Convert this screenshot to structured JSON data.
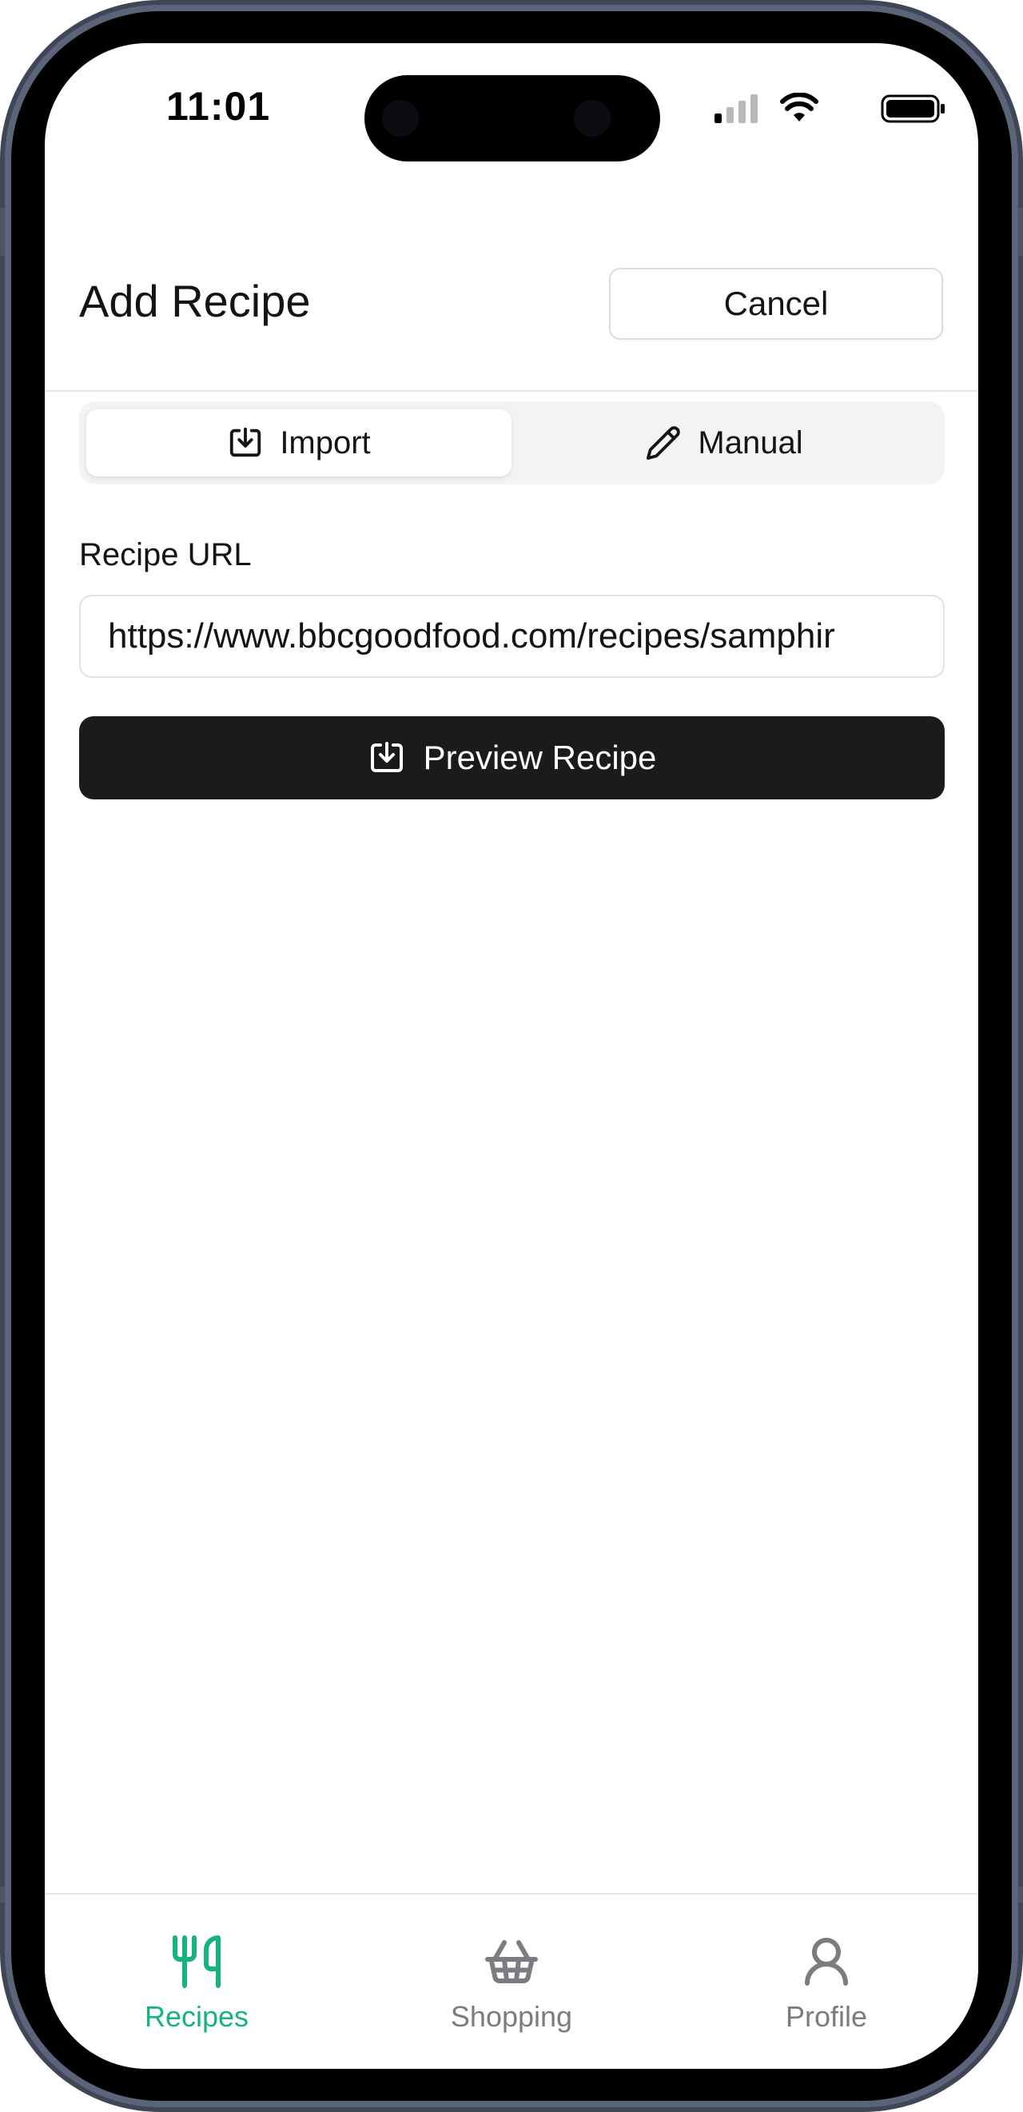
{
  "status_bar": {
    "time": "11:01"
  },
  "header": {
    "title": "Add Recipe",
    "cancel_label": "Cancel"
  },
  "segment": {
    "import_label": "Import",
    "manual_label": "Manual",
    "selected": "Import"
  },
  "form": {
    "url_label": "Recipe URL",
    "url_value": "https://www.bbcgoodfood.com/recipes/samphir",
    "preview_label": "Preview Recipe"
  },
  "tabbar": {
    "items": [
      {
        "label": "Recipes",
        "icon": "utensils-icon",
        "active": true
      },
      {
        "label": "Shopping",
        "icon": "basket-icon",
        "active": false
      },
      {
        "label": "Profile",
        "icon": "user-icon",
        "active": false
      }
    ]
  },
  "colors": {
    "accent": "#16b47c",
    "primary_button": "#1b1b1d",
    "inactive_tab": "#7c7c80"
  }
}
